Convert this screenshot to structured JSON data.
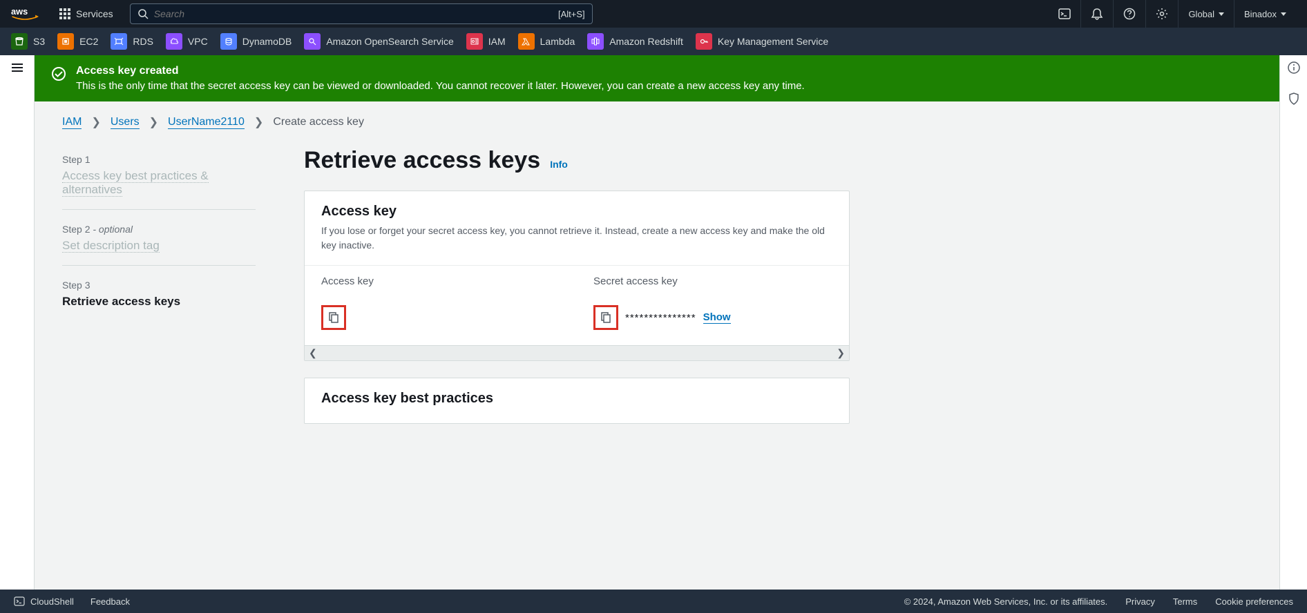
{
  "header": {
    "services_label": "Services",
    "search_placeholder": "Search",
    "search_shortcut": "[Alt+S]",
    "region": "Global",
    "account": "Binadox"
  },
  "service_bar": {
    "items": [
      {
        "label": "S3",
        "cls": "svc-s3"
      },
      {
        "label": "EC2",
        "cls": "svc-ec2"
      },
      {
        "label": "RDS",
        "cls": "svc-rds"
      },
      {
        "label": "VPC",
        "cls": "svc-vpc"
      },
      {
        "label": "DynamoDB",
        "cls": "svc-ddb"
      },
      {
        "label": "Amazon OpenSearch Service",
        "cls": "svc-os"
      },
      {
        "label": "IAM",
        "cls": "svc-iam"
      },
      {
        "label": "Lambda",
        "cls": "svc-lambda"
      },
      {
        "label": "Amazon Redshift",
        "cls": "svc-rs"
      },
      {
        "label": "Key Management Service",
        "cls": "svc-kms"
      }
    ]
  },
  "notice": {
    "title": "Access key created",
    "body": "This is the only time that the secret access key can be viewed or downloaded. You cannot recover it later. However, you can create a new access key any time."
  },
  "breadcrumb": {
    "iam": "IAM",
    "users": "Users",
    "username": "UserName2110",
    "current": "Create access key"
  },
  "steps": {
    "s1_num": "Step 1",
    "s1_title": "Access key best practices & alternatives",
    "s2_num": "Step 2",
    "s2_optional": " - optional",
    "s2_title": "Set description tag",
    "s3_num": "Step 3",
    "s3_title": "Retrieve access keys"
  },
  "page": {
    "title": "Retrieve access keys",
    "info": "Info"
  },
  "access_key_panel": {
    "title": "Access key",
    "description": "If you lose or forget your secret access key, you cannot retrieve it. Instead, create a new access key and make the old key inactive.",
    "col_access_key": "Access key",
    "col_secret_key": "Secret access key",
    "secret_masked": "***************",
    "show": "Show"
  },
  "best_practices_panel": {
    "title": "Access key best practices"
  },
  "footer": {
    "cloudshell": "CloudShell",
    "feedback": "Feedback",
    "copyright": "© 2024, Amazon Web Services, Inc. or its affiliates.",
    "privacy": "Privacy",
    "terms": "Terms",
    "cookies": "Cookie preferences"
  }
}
